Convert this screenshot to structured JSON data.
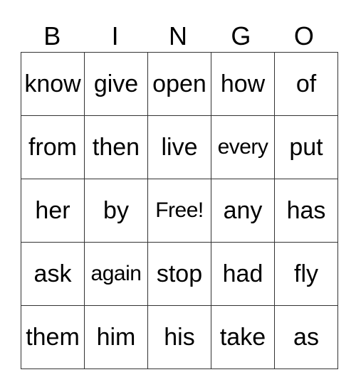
{
  "header": [
    "B",
    "I",
    "N",
    "G",
    "O"
  ],
  "rows": [
    [
      "know",
      "give",
      "open",
      "how",
      "of"
    ],
    [
      "from",
      "then",
      "live",
      "every",
      "put"
    ],
    [
      "her",
      "by",
      "Free!",
      "any",
      "has"
    ],
    [
      "ask",
      "again",
      "stop",
      "had",
      "fly"
    ],
    [
      "them",
      "him",
      "his",
      "take",
      "as"
    ]
  ]
}
